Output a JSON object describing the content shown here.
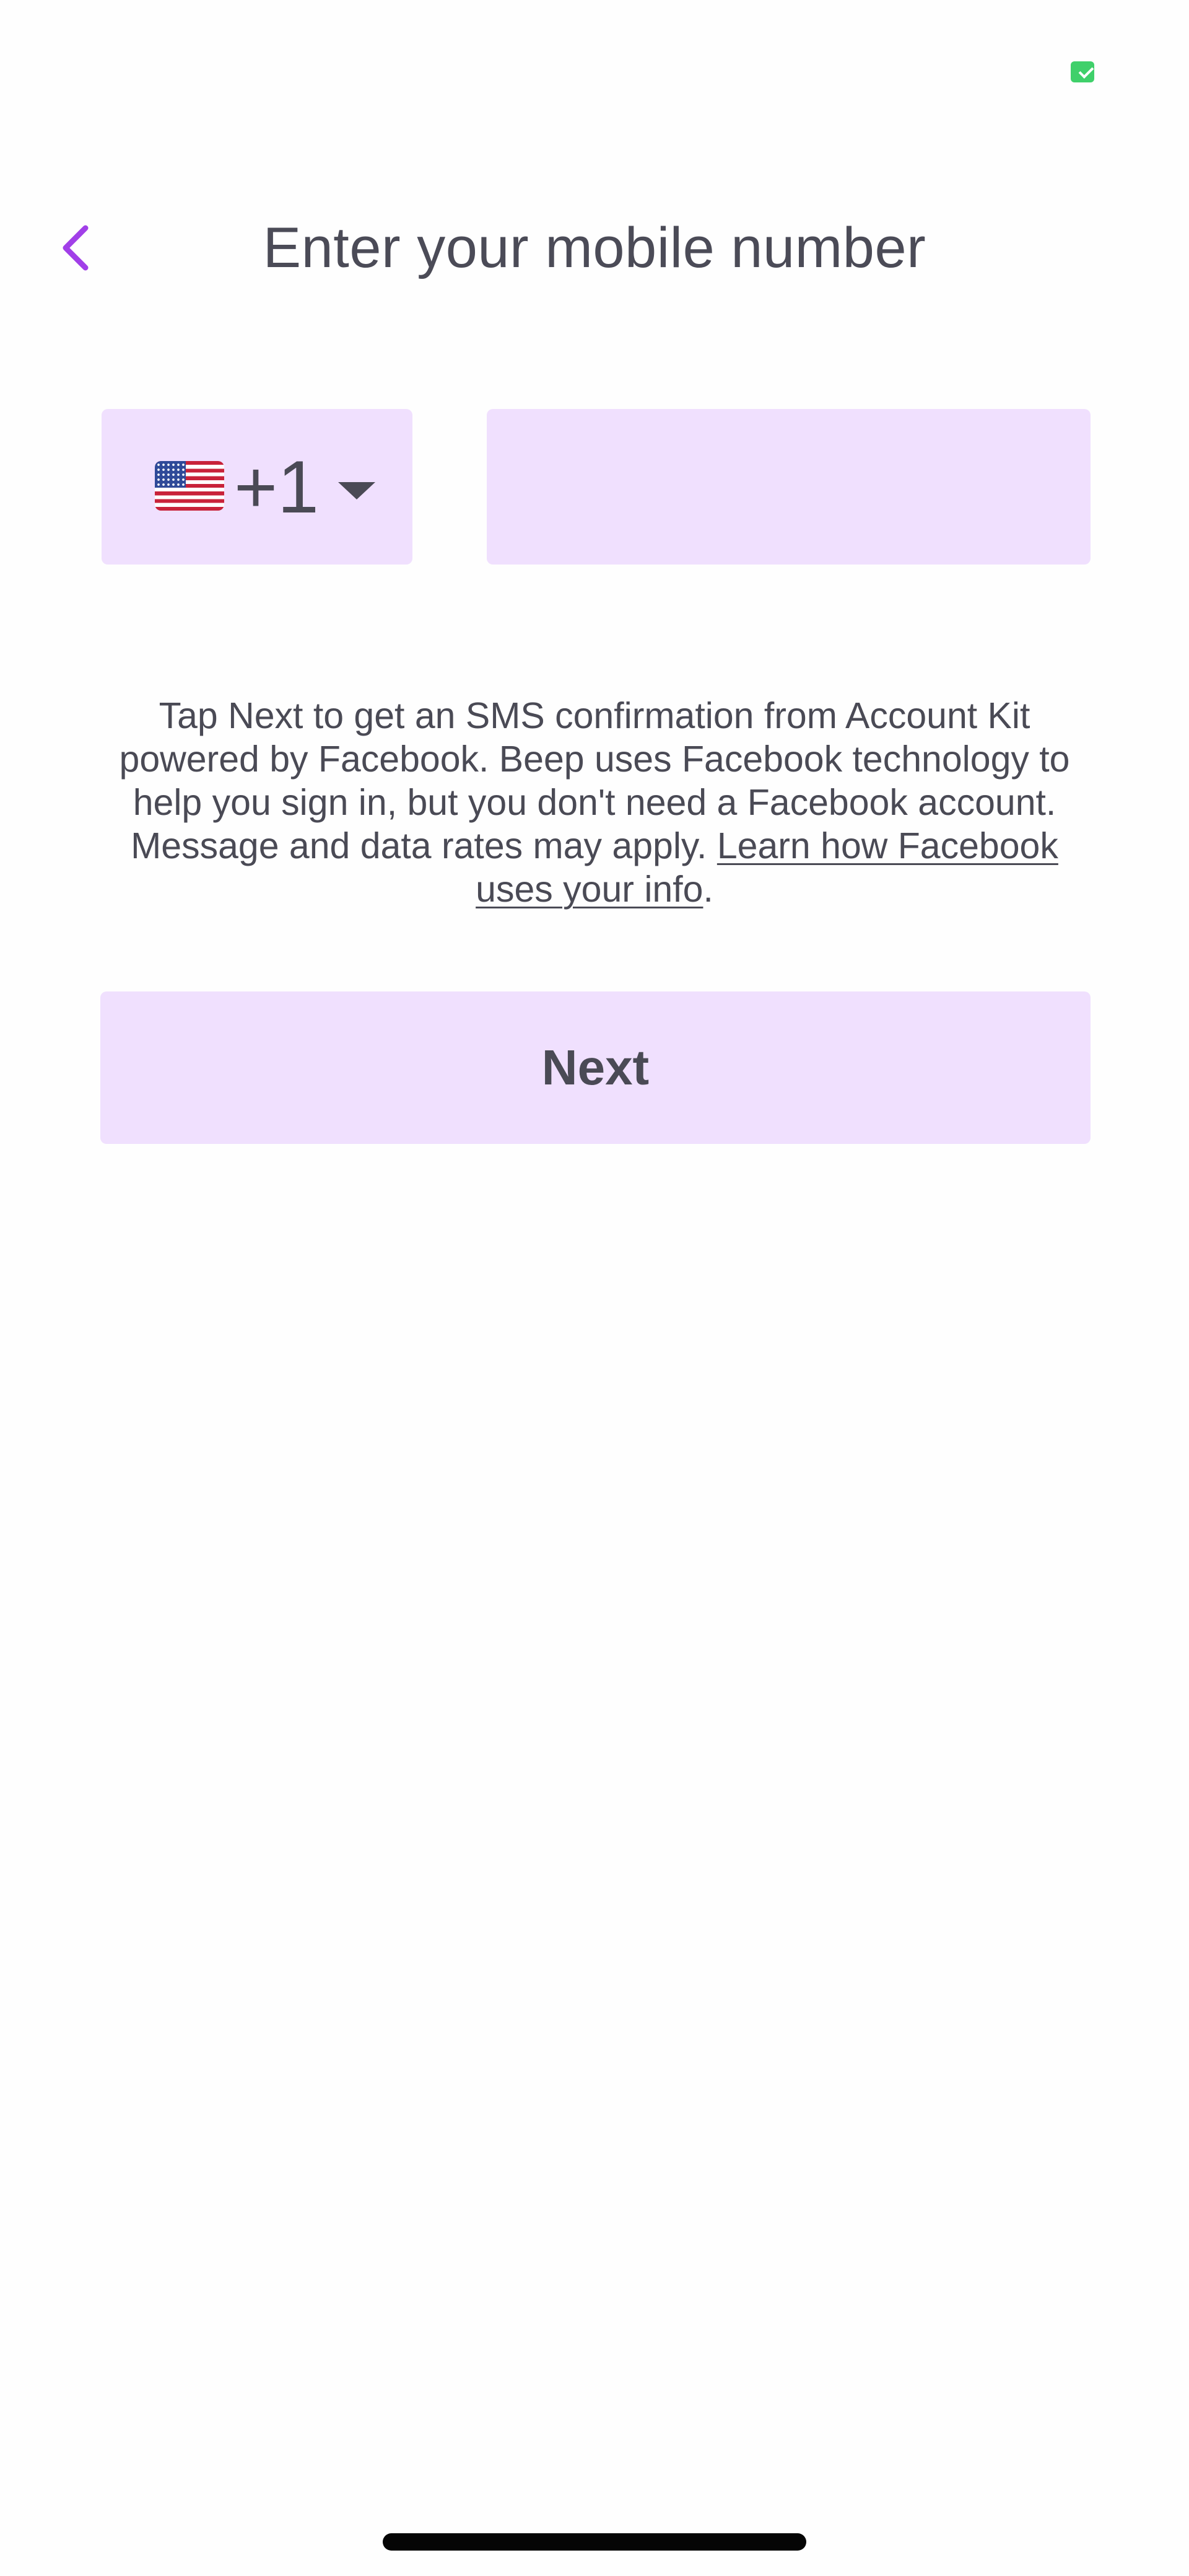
{
  "header": {
    "title": "Enter your mobile number"
  },
  "phone": {
    "country_flag": "us-flag-icon",
    "country_code": "+1",
    "number_value": "",
    "number_placeholder": ""
  },
  "info": {
    "text": "Tap Next to get an SMS confirmation from Account Kit powered by Facebook. Beep uses Facebook technology to help you sign in, but you don't need a Facebook account. Message and data rates may apply. ",
    "link_text": "Learn how Facebook uses your info",
    "suffix": "."
  },
  "actions": {
    "next_label": "Next"
  },
  "colors": {
    "accent": "#a13fe8",
    "field_background": "#f0e0fe",
    "text": "#4a4a55",
    "status_indicator": "#3fd06a"
  }
}
